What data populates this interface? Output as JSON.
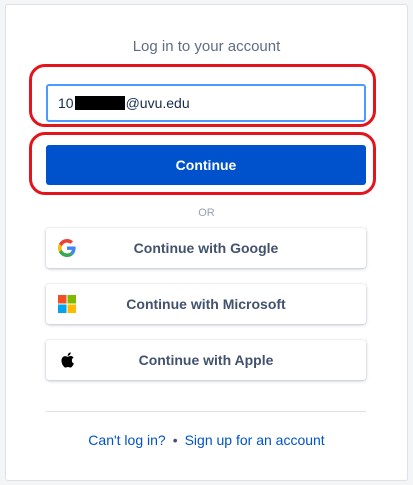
{
  "login": {
    "title": "Log in to your account",
    "email_prefix": "10",
    "email_suffix": "@uvu.edu",
    "continue_label": "Continue",
    "or_label": "OR",
    "google_label": "Continue with Google",
    "microsoft_label": "Continue with Microsoft",
    "apple_label": "Continue with Apple"
  },
  "footer": {
    "cant_login": "Can't log in?",
    "separator": "•",
    "signup": "Sign up for an account"
  },
  "colors": {
    "primary": "#0052cc",
    "input_focus": "#4c9aff",
    "annotation_ring": "#e3141c",
    "muted_text": "#5e6c84"
  },
  "icons": {
    "google": "google-logo-icon",
    "microsoft": "microsoft-logo-icon",
    "apple": "apple-logo-icon"
  }
}
